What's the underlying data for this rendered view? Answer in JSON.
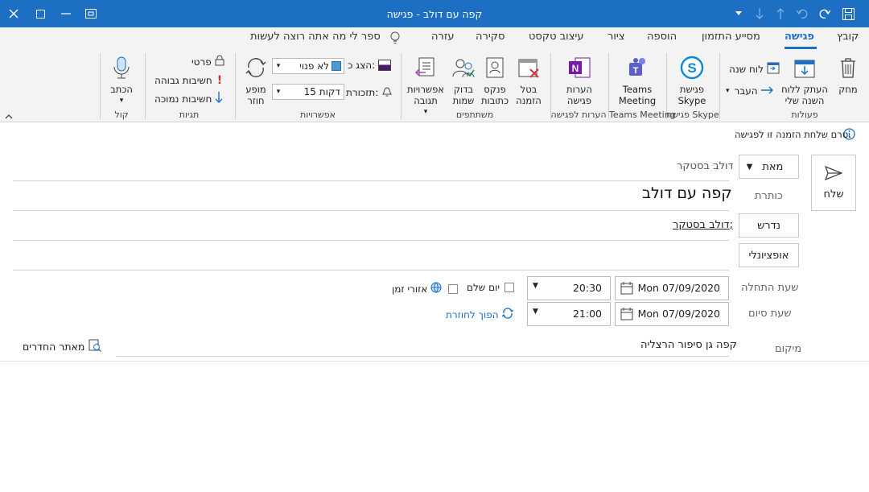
{
  "window": {
    "title": "קפה עם דולב  -  פגישה"
  },
  "tabs": [
    "קובץ",
    "פגישה",
    "מסייע התזמון",
    "הוספה",
    "ציור",
    "עיצוב טקסט",
    "סקירה",
    "עזרה"
  ],
  "tell_me": "ספר לי מה אתה רוצה לעשות",
  "ribbon": {
    "actions": {
      "delete": "מחק",
      "copy_cal": "העתק ללוח\nהשנה שלי",
      "calendar": "לוח שנה",
      "forward": "העבר",
      "group": "פעולות"
    },
    "skype": {
      "label": "פגישת\nSkype",
      "group": "פגישת Skype"
    },
    "teams": {
      "label": "Teams\nMeeting",
      "group": "Teams Meeting"
    },
    "notes": {
      "label": "הערות\nפגישה",
      "group": "הערות לפגישה"
    },
    "attendees": {
      "cancel": "בטל\nהזמנה",
      "address": "פנקס\nכתובות",
      "check": "בדוק\nשמות",
      "response": "אפשרויות\nתגובה",
      "group": "משתתפים"
    },
    "options": {
      "show_as_label": "הצג כ:",
      "show_as_value": "לא פנוי",
      "reminder_label": "תזכורת:",
      "reminder_value": "15 דקות",
      "recurrence": "מופע\nחוזר",
      "group": "אפשרויות"
    },
    "tags": {
      "private": "פרטי",
      "high": "חשיבות גבוהה",
      "low": "חשיבות נמוכה",
      "group": "תגיות"
    },
    "voice": {
      "dictate": "הכתב",
      "group": "קול"
    }
  },
  "info_message": "טרם שלחת הזמנה זו לפגישה.",
  "form": {
    "send": "שלח",
    "from_btn": "מאת",
    "from_value": "דולב בסטקר",
    "title_label": "כותרת",
    "title_value": "קפה עם דולב",
    "required_btn": "נדרש",
    "required_value": "דולב בסטקר;",
    "optional_btn": "אופציונלי",
    "start_label": "שעת התחלה",
    "start_date": "Mon 07/09/2020",
    "start_time": "20:30",
    "end_label": "שעת סיום",
    "end_date": "Mon 07/09/2020",
    "end_time": "21:00",
    "all_day": "יום שלם",
    "time_zones": "אזורי זמן",
    "recurring": "הפוך לחוזרת",
    "location_label": "מיקום",
    "location_value": "קפה גן סיפור הרצליה",
    "room_finder": "מאתר החדרים"
  },
  "colors": {
    "accent": "#1d6fc4",
    "busy": "#4a1a6b"
  }
}
